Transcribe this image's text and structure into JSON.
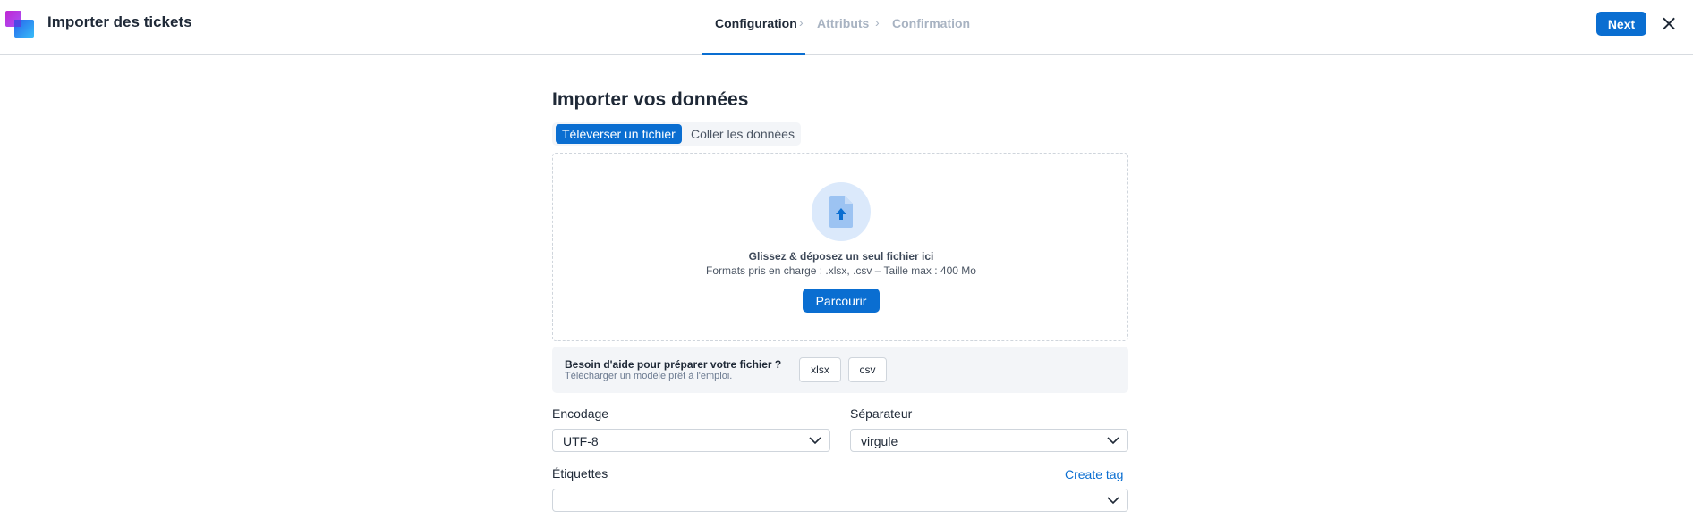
{
  "header": {
    "app_title": "Importer des tickets",
    "steps": [
      "Configuration",
      "Attributs",
      "Confirmation"
    ],
    "active_step": "Configuration",
    "next_label": "Next",
    "close_icon": "×"
  },
  "main": {
    "title": "Importer vos données",
    "tabs": [
      {
        "label": "Téléverser un fichier",
        "active": true
      },
      {
        "label": "Coller les données",
        "active": false
      }
    ],
    "dropzone": {
      "icon": "file-upload-icon",
      "title": "Glissez & déposez un seul fichier ici",
      "subtitle": "Formats pris en charge : .xlsx, .csv – Taille max : 400 Mo",
      "browse_label": "Parcourir"
    },
    "help": {
      "title": "Besoin d'aide pour préparer votre fichier ?",
      "subtitle": "Télécharger un modèle prêt à l'emploi.",
      "templates": [
        "xlsx",
        "csv"
      ]
    },
    "encoding": {
      "label": "Encodage",
      "value": "UTF-8"
    },
    "separator": {
      "label": "Séparateur",
      "value": "virgule"
    },
    "tags": {
      "label": "Étiquettes",
      "value": "",
      "create_label": "Create tag"
    }
  },
  "colors": {
    "accent": "#0a6ed1",
    "muted": "#a8b3c2",
    "panel": "#f3f5f8"
  }
}
